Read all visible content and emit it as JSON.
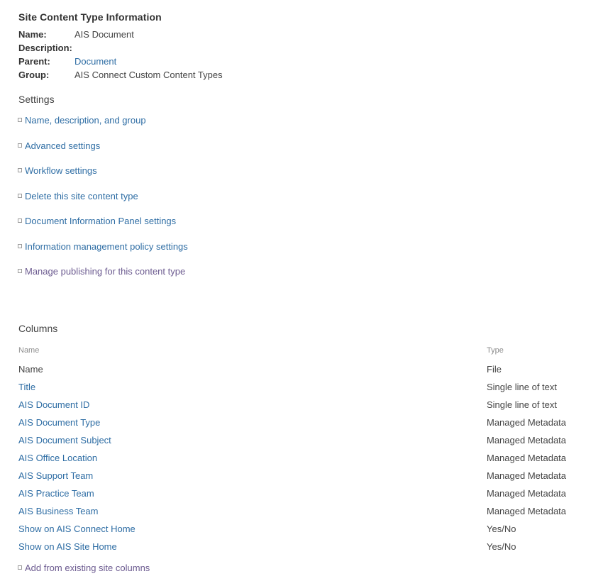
{
  "info": {
    "heading": "Site Content Type Information",
    "rows": [
      {
        "label": "Name:",
        "value": "AIS Document",
        "is_link": false
      },
      {
        "label": "Description:",
        "value": "",
        "is_link": false
      },
      {
        "label": "Parent:",
        "value": "Document",
        "is_link": true
      },
      {
        "label": "Group:",
        "value": "AIS Connect Custom Content Types",
        "is_link": false
      }
    ]
  },
  "settings": {
    "heading": "Settings",
    "items": [
      {
        "label": "Name, description, and group",
        "visited": false
      },
      {
        "label": "Advanced settings",
        "visited": false
      },
      {
        "label": "Workflow settings",
        "visited": false
      },
      {
        "label": "Delete this site content type",
        "visited": false
      },
      {
        "label": "Document Information Panel settings",
        "visited": false
      },
      {
        "label": "Information management policy settings",
        "visited": false
      },
      {
        "label": "Manage publishing for this content type",
        "visited": true
      }
    ]
  },
  "columns": {
    "heading": "Columns",
    "headers": {
      "name": "Name",
      "type": "Type"
    },
    "rows": [
      {
        "name": "Name",
        "type": "File",
        "is_link": false
      },
      {
        "name": "Title",
        "type": "Single line of text",
        "is_link": true
      },
      {
        "name": "AIS Document ID",
        "type": "Single line of text",
        "is_link": true
      },
      {
        "name": "AIS Document Type",
        "type": "Managed Metadata",
        "is_link": true
      },
      {
        "name": "AIS Document Subject",
        "type": "Managed Metadata",
        "is_link": true
      },
      {
        "name": "AIS Office Location",
        "type": "Managed Metadata",
        "is_link": true
      },
      {
        "name": "AIS Support Team",
        "type": "Managed Metadata",
        "is_link": true
      },
      {
        "name": "AIS Practice Team",
        "type": "Managed Metadata",
        "is_link": true
      },
      {
        "name": "AIS Business Team",
        "type": "Managed Metadata",
        "is_link": true
      },
      {
        "name": "Show on AIS Connect Home",
        "type": "Yes/No",
        "is_link": true
      },
      {
        "name": "Show on AIS Site Home",
        "type": "Yes/No",
        "is_link": true
      }
    ],
    "add_link": {
      "label": "Add from existing site columns",
      "visited": true
    }
  },
  "theme": {
    "link_color": "#2e6da4",
    "visited_link_color": "#6c5b90",
    "text_color": "#444444",
    "muted_color": "#8d8d8d",
    "background": "#ffffff"
  }
}
